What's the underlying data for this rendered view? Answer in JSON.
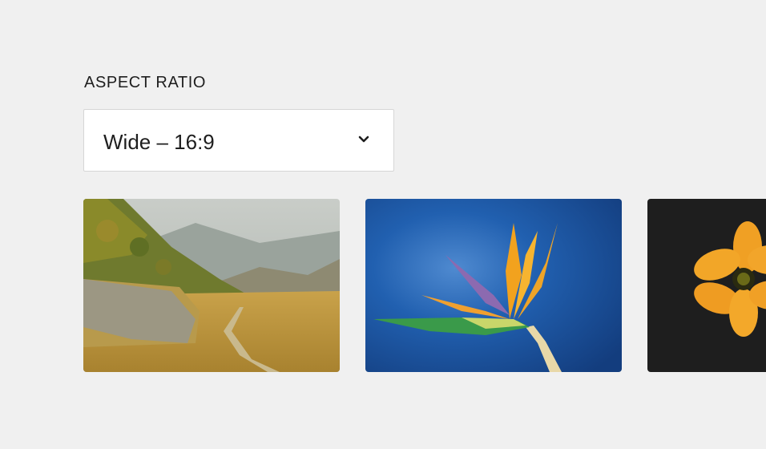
{
  "aspect_ratio": {
    "label": "ASPECT RATIO",
    "selected_value": "Wide – 16:9",
    "dropdown_icon": "chevron-down-icon"
  },
  "images": [
    {
      "subject": "mountain-meadow-trail"
    },
    {
      "subject": "bird-of-paradise-flower"
    },
    {
      "subject": "orange-cosmos-flower"
    }
  ],
  "colors": {
    "background": "#f0f0f0",
    "select_background": "#ffffff",
    "select_border": "#d6d6d6",
    "text": "#1e1e1e"
  }
}
